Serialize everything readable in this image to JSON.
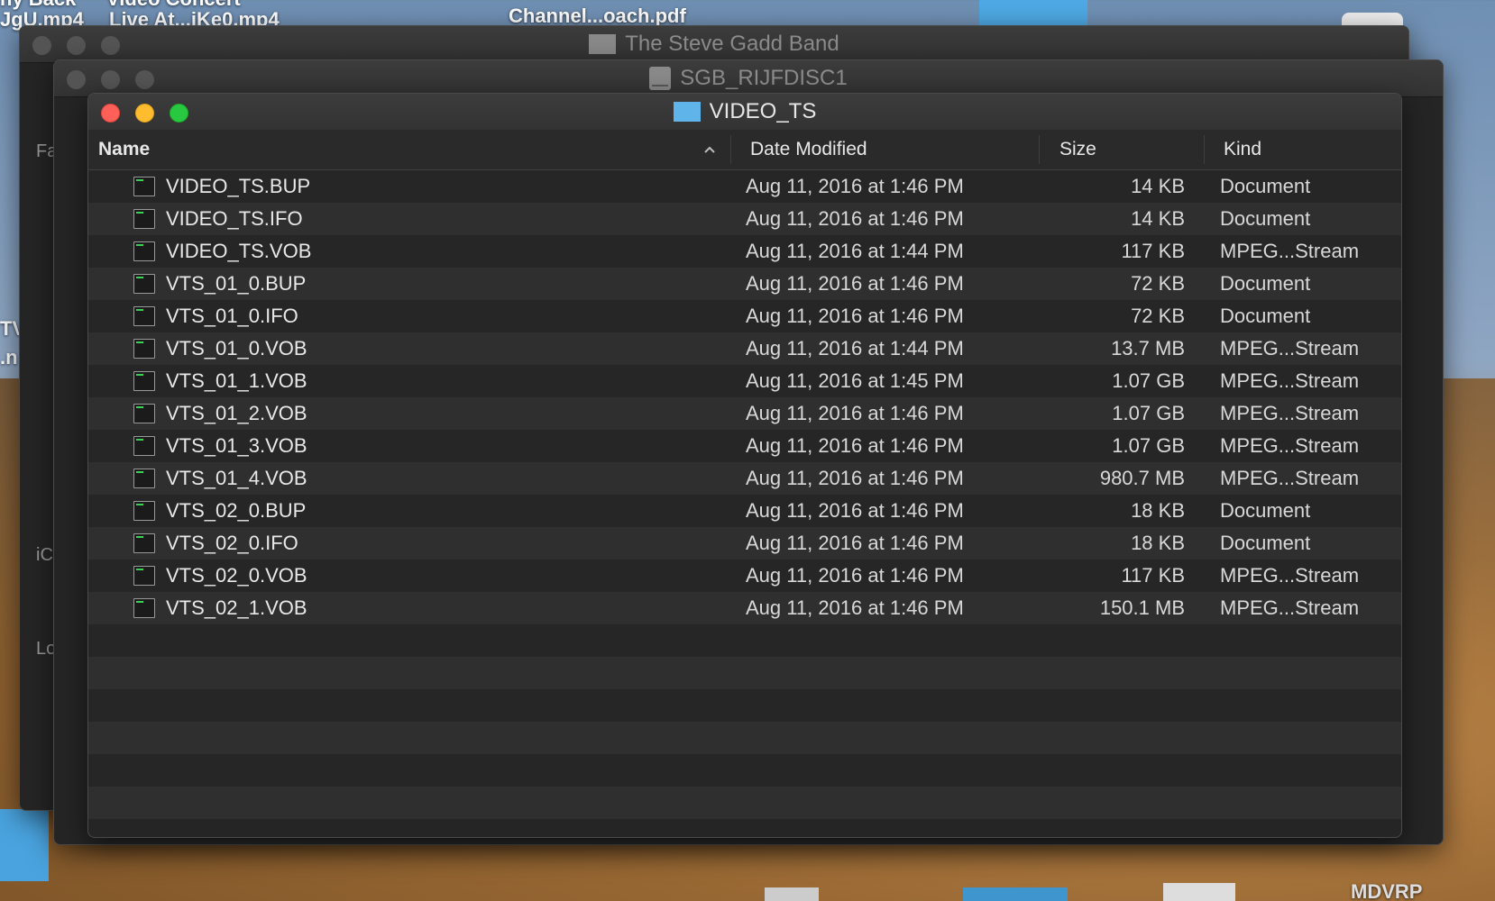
{
  "desktop": {
    "labels": [
      "ny Back",
      "Video Concert",
      "JgU.mp4",
      "Live At...iKe0.mp4",
      "Channel...oach.pdf",
      "TV",
      ".n",
      "MDVRP"
    ]
  },
  "windows": {
    "back": {
      "title": "The Steve Gadd Band"
    },
    "middle": {
      "title": "SGB_RIJFDISC1"
    },
    "main": {
      "title": "VIDEO_TS",
      "folder_color": "#5fb4ea"
    }
  },
  "back_sidebar": {
    "fragments": [
      "Fa",
      "iC",
      "Lo"
    ]
  },
  "columns": {
    "name": "Name",
    "date": "Date Modified",
    "size": "Size",
    "kind": "Kind"
  },
  "files": [
    {
      "name": "VIDEO_TS.BUP",
      "date": "Aug 11, 2016 at 1:46 PM",
      "size": "14 KB",
      "kind": "Document"
    },
    {
      "name": "VIDEO_TS.IFO",
      "date": "Aug 11, 2016 at 1:46 PM",
      "size": "14 KB",
      "kind": "Document"
    },
    {
      "name": "VIDEO_TS.VOB",
      "date": "Aug 11, 2016 at 1:44 PM",
      "size": "117 KB",
      "kind": "MPEG...Stream"
    },
    {
      "name": "VTS_01_0.BUP",
      "date": "Aug 11, 2016 at 1:46 PM",
      "size": "72 KB",
      "kind": "Document"
    },
    {
      "name": "VTS_01_0.IFO",
      "date": "Aug 11, 2016 at 1:46 PM",
      "size": "72 KB",
      "kind": "Document"
    },
    {
      "name": "VTS_01_0.VOB",
      "date": "Aug 11, 2016 at 1:44 PM",
      "size": "13.7 MB",
      "kind": "MPEG...Stream"
    },
    {
      "name": "VTS_01_1.VOB",
      "date": "Aug 11, 2016 at 1:45 PM",
      "size": "1.07 GB",
      "kind": "MPEG...Stream"
    },
    {
      "name": "VTS_01_2.VOB",
      "date": "Aug 11, 2016 at 1:46 PM",
      "size": "1.07 GB",
      "kind": "MPEG...Stream"
    },
    {
      "name": "VTS_01_3.VOB",
      "date": "Aug 11, 2016 at 1:46 PM",
      "size": "1.07 GB",
      "kind": "MPEG...Stream"
    },
    {
      "name": "VTS_01_4.VOB",
      "date": "Aug 11, 2016 at 1:46 PM",
      "size": "980.7 MB",
      "kind": "MPEG...Stream"
    },
    {
      "name": "VTS_02_0.BUP",
      "date": "Aug 11, 2016 at 1:46 PM",
      "size": "18 KB",
      "kind": "Document"
    },
    {
      "name": "VTS_02_0.IFO",
      "date": "Aug 11, 2016 at 1:46 PM",
      "size": "18 KB",
      "kind": "Document"
    },
    {
      "name": "VTS_02_0.VOB",
      "date": "Aug 11, 2016 at 1:46 PM",
      "size": "117 KB",
      "kind": "MPEG...Stream"
    },
    {
      "name": "VTS_02_1.VOB",
      "date": "Aug 11, 2016 at 1:46 PM",
      "size": "150.1 MB",
      "kind": "MPEG...Stream"
    }
  ],
  "icons": {
    "file": "file-icon",
    "folder": "folder-icon",
    "drive": "drive-icon",
    "sort": "sort-ascending-icon"
  }
}
